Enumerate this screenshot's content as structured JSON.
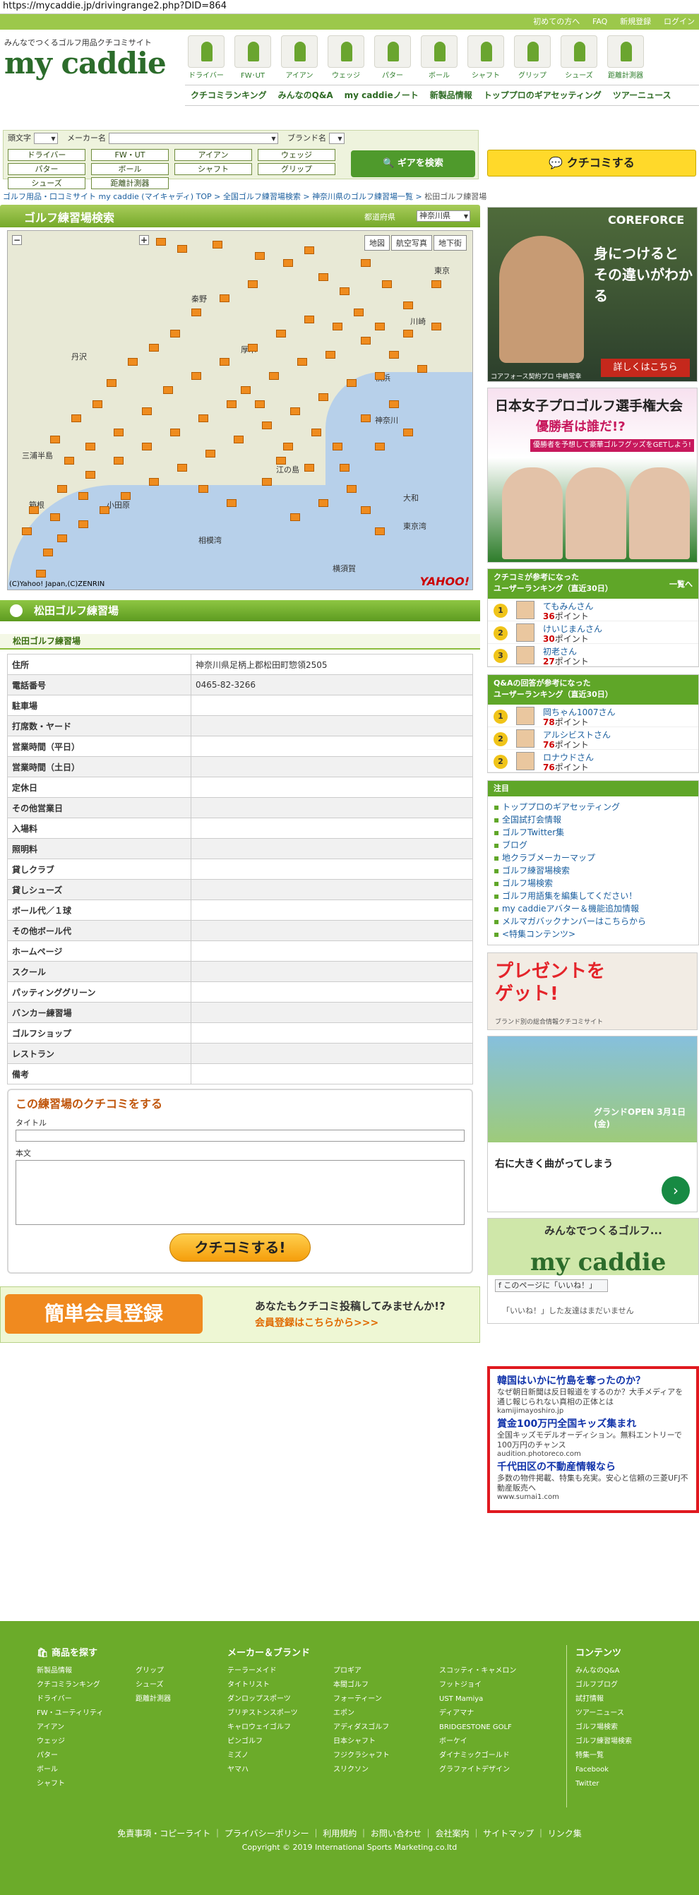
{
  "url": "https://mycaddie.jp/drivingrange2.php?DID=864",
  "topbar": [
    "初めての方へ",
    "FAQ",
    "新規登録",
    "ログイン"
  ],
  "logo": {
    "tagline": "みんなでつくるゴルフ用品クチコミサイト",
    "name": "my caddie"
  },
  "categories": [
    "ドライバー",
    "FW･UT",
    "アイアン",
    "ウェッジ",
    "パター",
    "ボール",
    "シャフト",
    "グリップ",
    "シューズ",
    "距離計測器"
  ],
  "mainnav": [
    "クチコミランキング",
    "みんなのQ&A",
    "my caddieノート",
    "新製品情報",
    "トッププロのギアセッティング",
    "ツアーニュース"
  ],
  "search": {
    "initial_label": "頭文字",
    "maker_label": "メーカー名",
    "brand_label": "ブランド名",
    "buttons": [
      "ドライバー",
      "FW・UT",
      "アイアン",
      "ウェッジ",
      "パター",
      "ボール",
      "シャフト",
      "グリップ",
      "シューズ",
      "距離計測器"
    ],
    "gear_button": "ギアを検索"
  },
  "kuchikomi_button": "クチコミする",
  "breadcrumb": [
    "ゴルフ用品・口コミサイト my caddie (マイキャディ) TOP",
    "全国ゴルフ練習場検索",
    "神奈川県のゴルフ練習場一覧",
    "松田ゴルフ練習場"
  ],
  "map": {
    "title": "ゴルフ練習場検索",
    "pref_label": "都道府県",
    "pref_value": "神奈川県",
    "tabs": [
      "地図",
      "航空写真",
      "地下街"
    ],
    "copyright": "(C)Yahoo! Japan,(C)ZENRIN",
    "brand": "YAHOO!",
    "places": [
      "秦野",
      "横浜",
      "厚木",
      "小田原",
      "相模湾",
      "江の島",
      "東京湾",
      "東京",
      "川崎",
      "丹沢",
      "箱根",
      "神奈川",
      "三浦半島",
      "横須賀",
      "大和"
    ]
  },
  "facility": {
    "name": "松田ゴルフ練習場",
    "subtitle": "松田ゴルフ練習場"
  },
  "info_rows": [
    {
      "k": "住所",
      "v": "神奈川県足柄上郡松田町惣領2505"
    },
    {
      "k": "電話番号",
      "v": "0465-82-3266"
    },
    {
      "k": "駐車場",
      "v": ""
    },
    {
      "k": "打席数・ヤード",
      "v": ""
    },
    {
      "k": "営業時間（平日）",
      "v": ""
    },
    {
      "k": "営業時間（土日）",
      "v": ""
    },
    {
      "k": "定休日",
      "v": ""
    },
    {
      "k": "その他営業日",
      "v": ""
    },
    {
      "k": "入場料",
      "v": ""
    },
    {
      "k": "照明料",
      "v": ""
    },
    {
      "k": "貸しクラブ",
      "v": ""
    },
    {
      "k": "貸しシューズ",
      "v": ""
    },
    {
      "k": "ボール代／１球",
      "v": ""
    },
    {
      "k": "その他ボール代",
      "v": ""
    },
    {
      "k": "ホームページ",
      "v": ""
    },
    {
      "k": "スクール",
      "v": ""
    },
    {
      "k": "パッティンググリーン",
      "v": ""
    },
    {
      "k": "バンカー練習場",
      "v": ""
    },
    {
      "k": "ゴルフショップ",
      "v": ""
    },
    {
      "k": "レストラン",
      "v": ""
    },
    {
      "k": "備考",
      "v": ""
    }
  ],
  "review": {
    "title": "この練習場のクチコミをする",
    "title_label": "タイトル",
    "body_label": "本文",
    "submit": "クチコミする!"
  },
  "register": {
    "badge": "簡単会員登録",
    "line1": "あなたもクチコミ投稿してみませんか!?",
    "line2": "会員登録はこちらから>>>"
  },
  "ads": {
    "coreforce": {
      "brand": "COREFORCE",
      "copy1": "身につけると",
      "copy2": "その違いがわかる",
      "caption": "コアフォース契約プロ 中嶋常幸",
      "button": "詳しくはこちら"
    },
    "ladies": {
      "title": "日本女子プロゴルフ選手権大会",
      "sub": "優勝者は誰だ!?",
      "bar": "優勝者を予想して豪華ゴルフグッズをGETしよう!"
    },
    "present": {
      "line1": "プレゼントを",
      "line2": "ゲット!",
      "sub": "ブランド別の総合情報クチコミサイト"
    },
    "range": {
      "banner": "グランドOPEN 3月1日(金)",
      "headline": "右に大きく曲がってしまう",
      "arrow": "›"
    }
  },
  "rank_kuchikomi": {
    "title": "クチコミが参考になった\nユーザーランキング（直近30日）",
    "more": "一覧へ",
    "rows": [
      {
        "n": "1",
        "u": "てもみんさん",
        "p": "36"
      },
      {
        "n": "2",
        "u": "けいじまんさん",
        "p": "30"
      },
      {
        "n": "3",
        "u": "初老さん",
        "p": "27"
      }
    ]
  },
  "rank_qa": {
    "title": "Q&Aの回答が参考になった\nユーザーランキング（直近30日）",
    "rows": [
      {
        "n": "1",
        "u": "岡ちゃん1007さん",
        "p": "78"
      },
      {
        "n": "2",
        "u": "アルシビストさん",
        "p": "76"
      },
      {
        "n": "2",
        "u": "ロナウドさん",
        "p": "76"
      }
    ]
  },
  "points_label": "ポイント",
  "notes": {
    "title": "注目",
    "items": [
      "トッププロのギアセッティング",
      "全国試打会情報",
      "ゴルフTwitter集",
      "ブログ",
      "地クラブメーカーマップ",
      "ゴルフ練習場検索",
      "ゴルフ場検索",
      "ゴルフ用語集を編集してください！",
      "my caddieアバター＆機能追加情報",
      "メルマガバックナンバーはこちらから",
      "<特集コンテンツ>"
    ]
  },
  "facebook": {
    "name": "みんなでつくるゴルフ...",
    "big": "my caddie",
    "like": "このページに「いいね！」",
    "msg": "「いいね！」した友達はまだいません"
  },
  "textads": [
    {
      "h": "韓国はいかに竹島を奪ったのか？",
      "d": "なぜ朝日新聞は反日報道をするのか？大手メディアを通じ報じられない真相の正体とは",
      "u": "kamijimayoshiro.jp"
    },
    {
      "h": "賞金100万円全国キッズ集まれ",
      "d": "全国キッズモデルオーディション。無料エントリーで100万円のチャンス",
      "u": "audition.photoreco.com"
    },
    {
      "h": "千代田区の不動産情報なら",
      "d": "多数の物件掲載、特集も充実。安心と信頼の三菱UFJ不動産販売へ",
      "u": "www.sumai1.com"
    }
  ],
  "footer": {
    "goods_title": "商品を探す",
    "goods": [
      "新製品情報",
      "クチコミランキング",
      "ドライバー",
      "FW・ユーティリティ",
      "アイアン",
      "ウェッジ",
      "パター",
      "ボール",
      "シャフト"
    ],
    "goods2": [
      "グリップ",
      "シューズ",
      "距離計測器"
    ],
    "maker_title": "メーカー＆ブランド",
    "makers": [
      [
        "テーラーメイド",
        "タイトリスト",
        "ダンロップスポーツ",
        "ブリヂストンスポーツ",
        "キャロウェイゴルフ",
        "ピンゴルフ",
        "ミズノ",
        "ヤマハ"
      ],
      [
        "プロギア",
        "本間ゴルフ",
        "フォーティーン",
        "エポン",
        "アディダスゴルフ",
        "日本シャフト",
        "フジクラシャフト",
        "スリクソン"
      ],
      [
        "スコッティ・キャメロン",
        "フットジョイ",
        "UST Mamiya",
        "ディアマナ",
        "BRIDGESTONE GOLF",
        "ボーケイ",
        "ダイナミックゴールド",
        "グラファイトデザイン"
      ]
    ],
    "contents_title": "コンテンツ",
    "contents": [
      "みんなのQ&A",
      "ゴルフブログ",
      "試打情報",
      "ツアーニュース",
      "ゴルフ場検索",
      "ゴルフ練習場検索",
      "特集一覧",
      "Facebook",
      "Twitter"
    ],
    "links": "免責事項・コピーライト ｜ プライバシーポリシー ｜ 利用規約 ｜ お問い合わせ ｜ 会社案内 ｜ サイトマップ ｜ リンク集",
    "copyright": "Copyright © 2019 International Sports Marketing.co.ltd"
  }
}
